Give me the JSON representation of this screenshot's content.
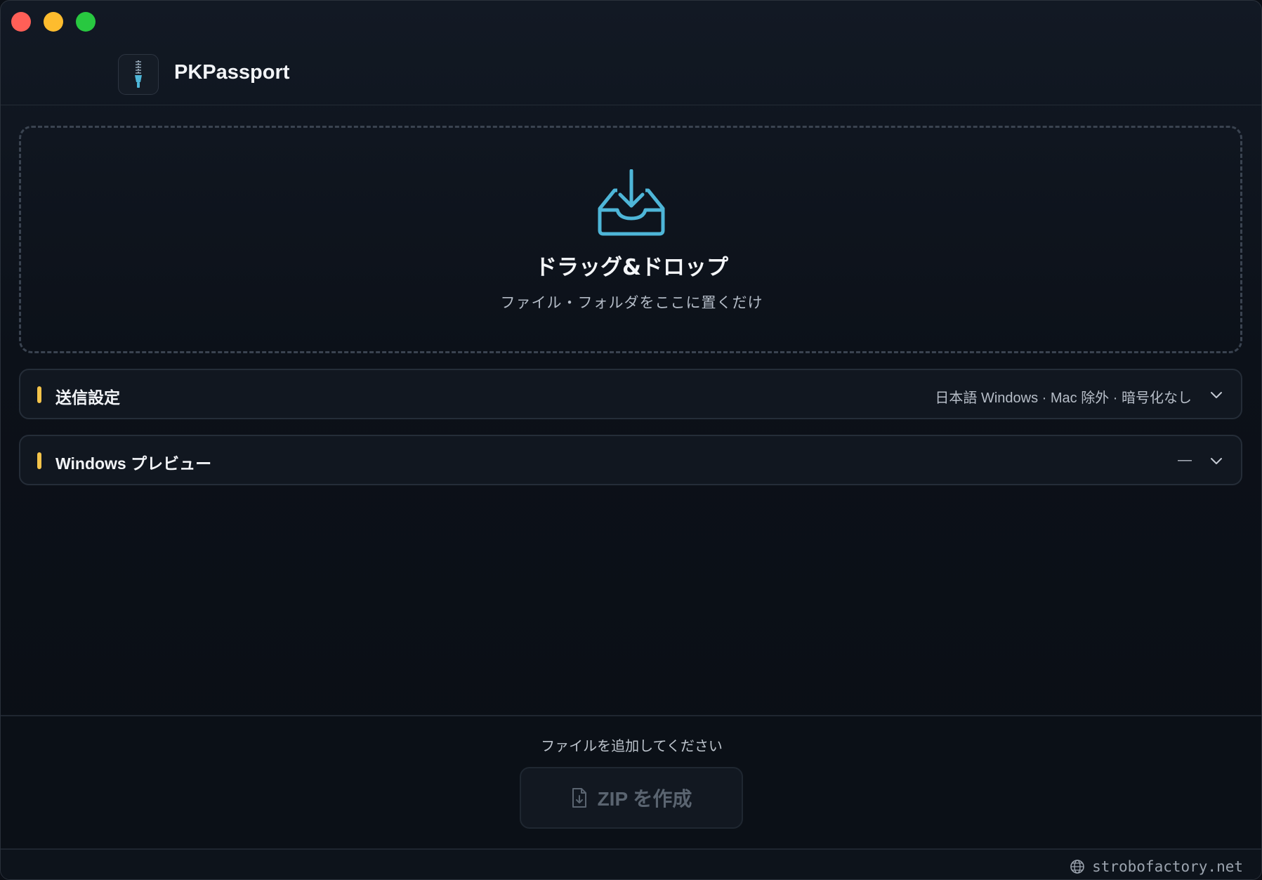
{
  "window": {
    "controls": [
      "close",
      "minimize",
      "maximize"
    ]
  },
  "header": {
    "app_icon": "zipper-icon",
    "app_name": "PKPassport"
  },
  "dropzone": {
    "icon": "inbox-download-icon",
    "title": "ドラッグ&ドロップ",
    "subtitle": "ファイル・フォルダをここに置くだけ"
  },
  "panels": [
    {
      "title": "送信設定",
      "summary": "日本語 Windows · Mac 除外 · 暗号化なし",
      "expanded": false
    },
    {
      "title": "Windows プレビュー",
      "summary": "—",
      "expanded": false
    }
  ],
  "footer": {
    "status": "ファイルを追加してください",
    "zip_button": {
      "label": "ZIP を作成",
      "icon": "file-download-icon",
      "enabled": false
    }
  },
  "bottom_bar": {
    "site_icon": "globe-icon",
    "site": "strobofactory.net"
  },
  "colors": {
    "accent": "#f3c34a",
    "icon_blue": "#4eb6d8",
    "close": "#ff5f57",
    "minimize": "#febc2e",
    "maximize": "#28c840"
  }
}
